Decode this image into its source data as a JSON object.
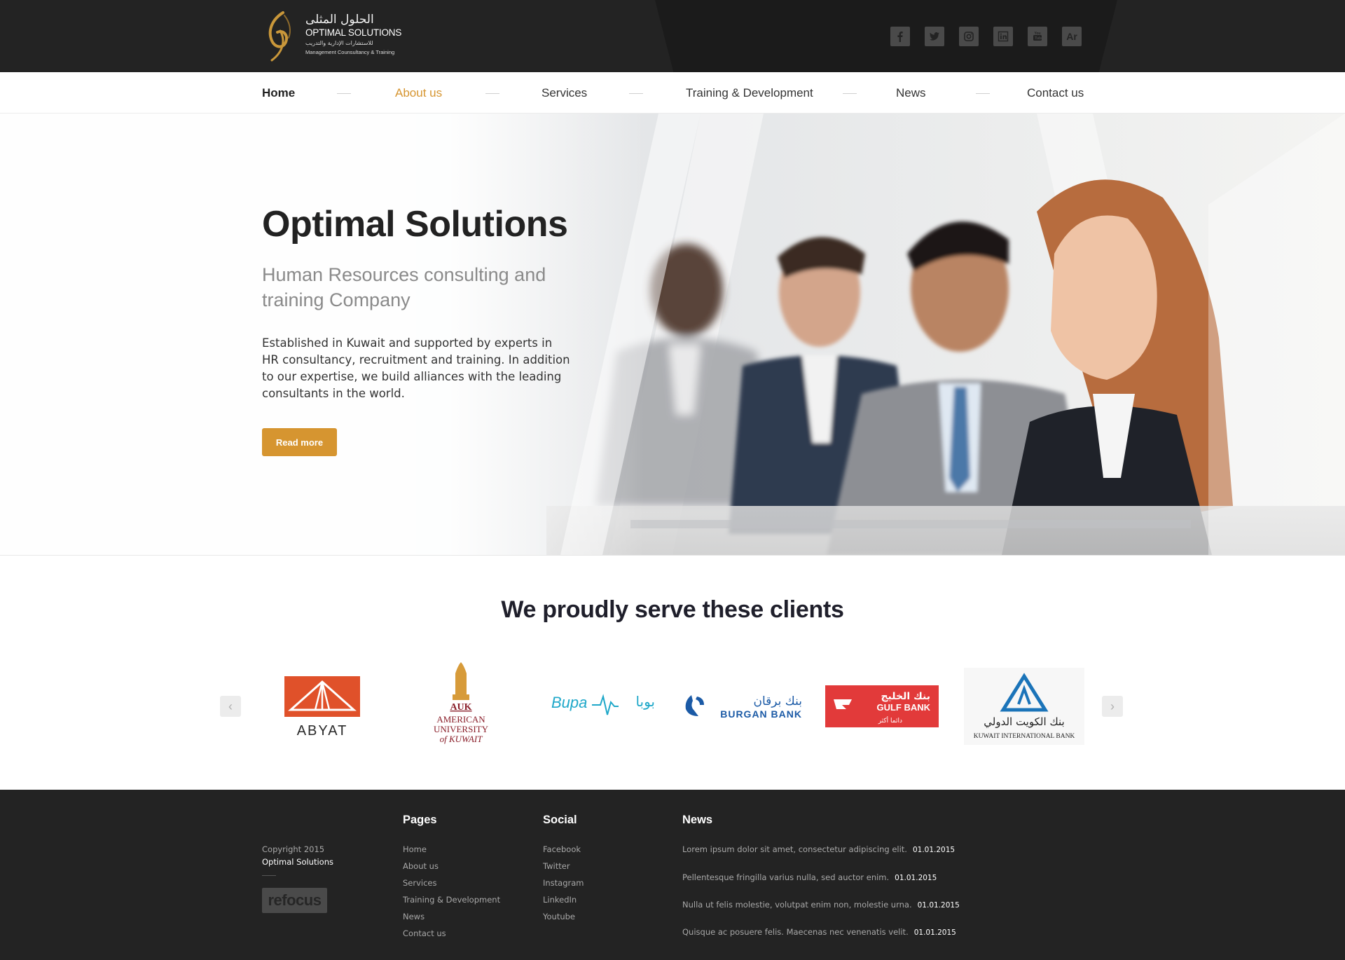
{
  "header": {
    "logo": {
      "arabic_name": "الحلول المثلى",
      "english_name": "OPTIMAL SOLUTIONS",
      "arabic_tagline": "للاستشارات الإدارية والتدريب",
      "english_tagline": "Management Counsultancy & Training"
    },
    "social": [
      {
        "icon": "facebook-icon",
        "label": "f"
      },
      {
        "icon": "twitter-icon",
        "label": "t"
      },
      {
        "icon": "instagram-icon",
        "label": "ig"
      },
      {
        "icon": "linkedin-icon",
        "label": "in"
      },
      {
        "icon": "youtube-icon",
        "label": "yt"
      },
      {
        "icon": "arabic-language-icon",
        "label": "Ar"
      }
    ]
  },
  "nav": {
    "items": [
      "Home",
      "About us",
      "Services",
      "Training & Development",
      "News",
      "Contact us"
    ],
    "active": "About us"
  },
  "hero": {
    "title": "Optimal Solutions",
    "subtitle": "Human Resources consulting and training Company",
    "body": "Established in Kuwait and supported by experts in HR consultancy, recruitment and training. In addition to our expertise, we build alliances with the leading consultants in the world.",
    "button": "Read more"
  },
  "clients": {
    "title": "We proudly serve these clients",
    "logos": [
      {
        "name": "ABYAT",
        "text": "ABYAT"
      },
      {
        "name": "AUK",
        "text": "AUK",
        "line1": "AMERICAN",
        "line2": "UNIVERSITY",
        "line3": "of KUWAIT"
      },
      {
        "name": "Bupa",
        "text": "Bupa",
        "arabic": "بوبا"
      },
      {
        "name": "Burgan Bank",
        "text": "BURGAN BANK",
        "arabic": "بنك برقان"
      },
      {
        "name": "Gulf Bank",
        "text": "GULF BANK",
        "arabic": "بنك الخليج",
        "tagline": "دائما أكثر"
      },
      {
        "name": "Kuwait International Bank",
        "text": "KUWAIT INTERNATIONAL BANK",
        "arabic": "بنك الكويت الدولي"
      }
    ],
    "prev_arrow": "‹",
    "next_arrow": "›"
  },
  "footer": {
    "copyright_line1": "Copyright 2015",
    "copyright_line2": "Optimal Solutions",
    "badge": "refocus",
    "pages_title": "Pages",
    "pages": [
      "Home",
      "About us",
      "Services",
      "Training & Development",
      "News",
      "Contact us"
    ],
    "social_title": "Social",
    "social": [
      "Facebook",
      "Twitter",
      "Instagram",
      "LinkedIn",
      "Youtube"
    ],
    "news_title": "News",
    "news": [
      {
        "text": "Lorem ipsum dolor sit amet, consectetur adipiscing elit.",
        "date": "01.01.2015"
      },
      {
        "text": "Pellentesque fringilla varius nulla, sed auctor enim.",
        "date": "01.01.2015"
      },
      {
        "text": "Nulla ut felis molestie, volutpat enim non, molestie urna.",
        "date": "01.01.2015"
      },
      {
        "text": "Quisque ac posuere felis. Maecenas nec venenatis velit.",
        "date": "01.01.2015"
      }
    ]
  },
  "colors": {
    "accent": "#d69530",
    "dark_bg": "#232323",
    "text_dark": "#222222",
    "text_muted": "#8a8a8a"
  }
}
